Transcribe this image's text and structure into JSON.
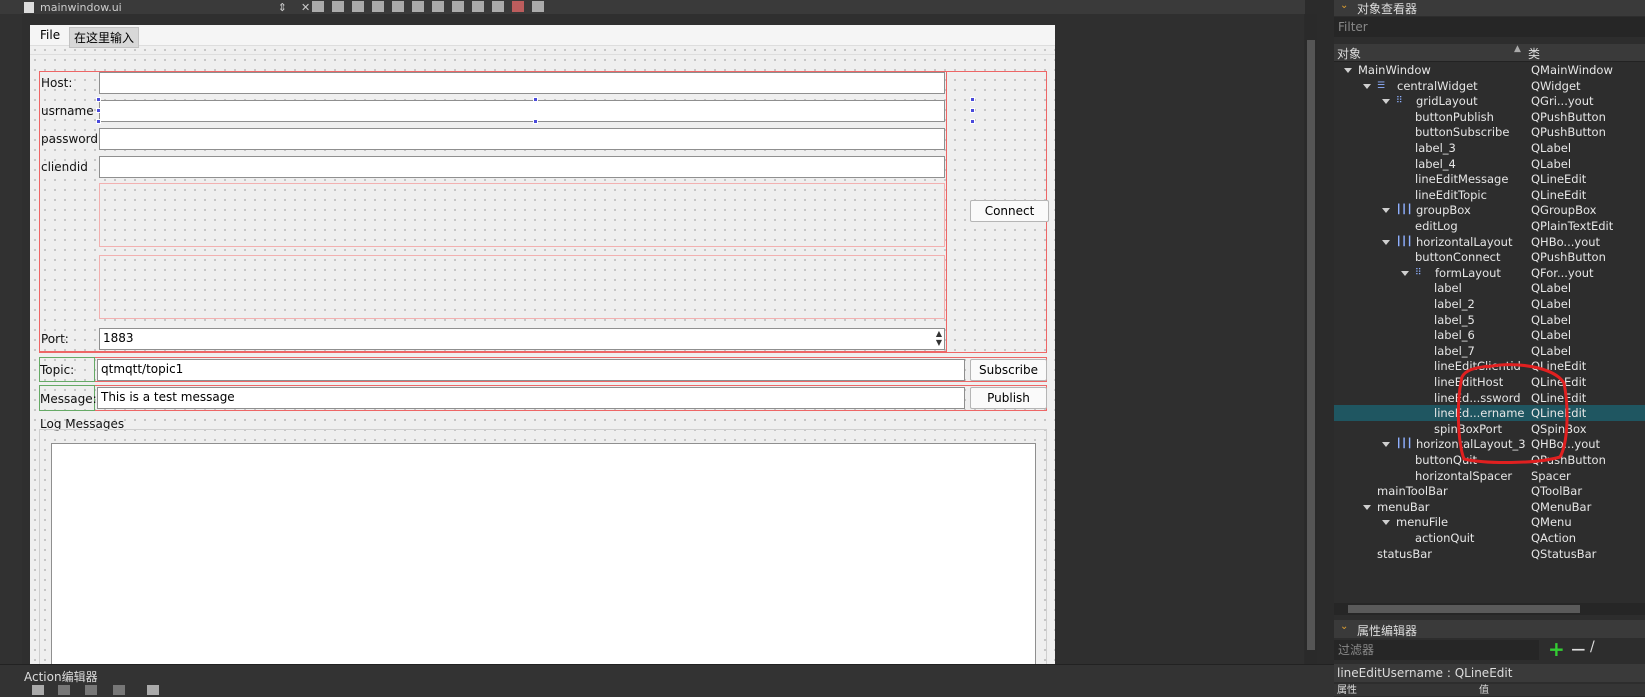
{
  "file_tab": {
    "name": "mainwindow.ui"
  },
  "form_menu": {
    "file": "File",
    "type_here": "在这里输入"
  },
  "connection": {
    "host_label": "Host:",
    "username_label": "usrname",
    "password_label": "password",
    "clientid_label": "cliendid",
    "port_label": "Port:",
    "port_value": "1883",
    "connect_button": "Connect"
  },
  "topic": {
    "label": "Topic:",
    "value": "qtmqtt/topic1",
    "button": "Subscribe"
  },
  "message": {
    "label": "Message:",
    "value": "This is a test message",
    "button": "Publish"
  },
  "log": {
    "label": "Log Messages"
  },
  "object_inspector": {
    "title": "对象查看器",
    "filter_placeholder": "Filter",
    "col_object": "对象",
    "col_class": "类",
    "rows": [
      {
        "obj": "MainWindow",
        "cls": "QMainWindow",
        "lvl": 0,
        "arrow": true
      },
      {
        "obj": "centralWidget",
        "cls": "QWidget",
        "lvl": 1,
        "arrow": true,
        "icon": "widget"
      },
      {
        "obj": "gridLayout",
        "cls": "QGri...yout",
        "lvl": 2,
        "arrow": true,
        "icon": "grid"
      },
      {
        "obj": "buttonPublish",
        "cls": "QPushButton",
        "lvl": 3
      },
      {
        "obj": "buttonSubscribe",
        "cls": "QPushButton",
        "lvl": 3
      },
      {
        "obj": "label_3",
        "cls": "QLabel",
        "lvl": 3
      },
      {
        "obj": "label_4",
        "cls": "QLabel",
        "lvl": 3
      },
      {
        "obj": "lineEditMessage",
        "cls": "QLineEdit",
        "lvl": 3
      },
      {
        "obj": "lineEditTopic",
        "cls": "QLineEdit",
        "lvl": 3
      },
      {
        "obj": "groupBox",
        "cls": "QGroupBox",
        "lvl": 2,
        "arrow": true,
        "icon": "hbox"
      },
      {
        "obj": "editLog",
        "cls": "QPlainTextEdit",
        "lvl": 3
      },
      {
        "obj": "horizontalLayout",
        "cls": "QHBo...yout",
        "lvl": 2,
        "arrow": true,
        "icon": "hbox"
      },
      {
        "obj": "buttonConnect",
        "cls": "QPushButton",
        "lvl": 3
      },
      {
        "obj": "formLayout",
        "cls": "QFor...yout",
        "lvl": 3,
        "arrow": true,
        "icon": "form"
      },
      {
        "obj": "label",
        "cls": "QLabel",
        "lvl": 4
      },
      {
        "obj": "label_2",
        "cls": "QLabel",
        "lvl": 4
      },
      {
        "obj": "label_5",
        "cls": "QLabel",
        "lvl": 4
      },
      {
        "obj": "label_6",
        "cls": "QLabel",
        "lvl": 4
      },
      {
        "obj": "label_7",
        "cls": "QLabel",
        "lvl": 4
      },
      {
        "obj": "lineEditClientid",
        "cls": "QLineEdit",
        "lvl": 4
      },
      {
        "obj": "lineEditHost",
        "cls": "QLineEdit",
        "lvl": 4
      },
      {
        "obj": "lineEd...ssword",
        "cls": "QLineEdit",
        "lvl": 4
      },
      {
        "obj": "lineEd...ername",
        "cls": "QLineEdit",
        "lvl": 4,
        "selected": true
      },
      {
        "obj": "spinBoxPort",
        "cls": "QSpinBox",
        "lvl": 4
      },
      {
        "obj": "horizontalLayout_3",
        "cls": "QHBo...yout",
        "lvl": 2,
        "arrow": true,
        "icon": "hbox"
      },
      {
        "obj": "buttonQuit",
        "cls": "QPushButton",
        "lvl": 3
      },
      {
        "obj": "horizontalSpacer",
        "cls": "Spacer",
        "lvl": 3
      },
      {
        "obj": "mainToolBar",
        "cls": "QToolBar",
        "lvl": 1
      },
      {
        "obj": "menuBar",
        "cls": "QMenuBar",
        "lvl": 1,
        "arrow": true
      },
      {
        "obj": "menuFile",
        "cls": "QMenu",
        "lvl": 2,
        "arrow": true
      },
      {
        "obj": "actionQuit",
        "cls": "QAction",
        "lvl": 3
      },
      {
        "obj": "statusBar",
        "cls": "QStatusBar",
        "lvl": 1
      }
    ]
  },
  "property_editor": {
    "title": "属性编辑器",
    "filter_placeholder": "过滤器",
    "selected_info": "lineEditUsername : QLineEdit",
    "col_property": "属性",
    "col_value": "值"
  },
  "action_editor": {
    "title": "Action编辑器"
  },
  "colors": {
    "selection": "#1f5661",
    "layout_border": "#ee6666",
    "annotation": "#e02020"
  }
}
